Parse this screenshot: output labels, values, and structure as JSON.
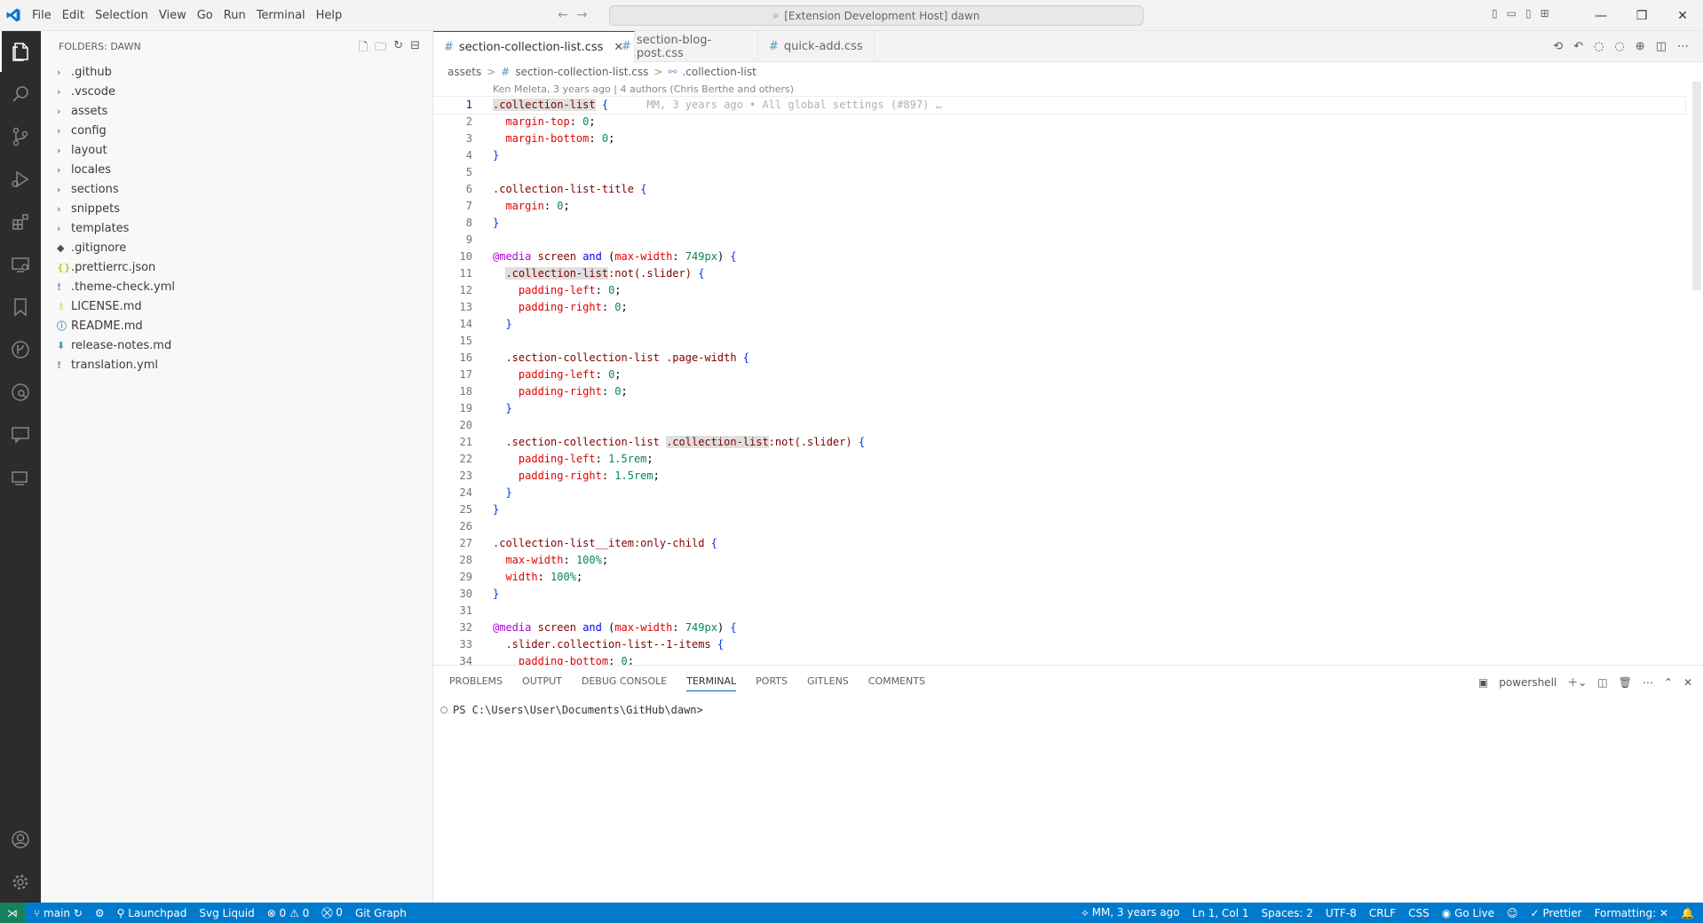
{
  "menubar": {
    "items": [
      "File",
      "Edit",
      "Selection",
      "View",
      "Go",
      "Run",
      "Terminal",
      "Help"
    ]
  },
  "title": {
    "nav_back": "←",
    "nav_forward": "→",
    "command_center": "[Extension Development Host] dawn"
  },
  "window_controls": {
    "minimize": "—",
    "restore": "❐",
    "close": "✕"
  },
  "sidebar": {
    "header": "FOLDERS: DAWN",
    "items": [
      {
        "label": ".github",
        "type": "folder"
      },
      {
        "label": ".vscode",
        "type": "folder"
      },
      {
        "label": "assets",
        "type": "folder"
      },
      {
        "label": "config",
        "type": "folder"
      },
      {
        "label": "layout",
        "type": "folder"
      },
      {
        "label": "locales",
        "type": "folder"
      },
      {
        "label": "sections",
        "type": "folder"
      },
      {
        "label": "snippets",
        "type": "folder"
      },
      {
        "label": "templates",
        "type": "folder"
      },
      {
        "label": ".gitignore",
        "type": "file",
        "icon": "◆",
        "color": "#41535b"
      },
      {
        "label": ".prettierrc.json",
        "type": "file",
        "icon": "{}",
        "color": "#cbcb41"
      },
      {
        "label": ".theme-check.yml",
        "type": "file",
        "icon": "!",
        "color": "#a074c4"
      },
      {
        "label": "LICENSE.md",
        "type": "file",
        "icon": "♗",
        "color": "#cbcb41"
      },
      {
        "label": "README.md",
        "type": "file",
        "icon": "ⓘ",
        "color": "#519aba"
      },
      {
        "label": "release-notes.md",
        "type": "file",
        "icon": "⬇",
        "color": "#519aba"
      },
      {
        "label": "translation.yml",
        "type": "file",
        "icon": "!",
        "color": "#a074c4"
      }
    ]
  },
  "tabs": [
    {
      "label": "section-collection-list.css",
      "active": true,
      "close": "✕"
    },
    {
      "label": "section-blog-post.css",
      "active": false
    },
    {
      "label": "quick-add.css",
      "active": false
    }
  ],
  "breadcrumbs": {
    "folder": "assets",
    "file": "section-collection-list.css",
    "symbol": ".collection-list",
    "sep": ">"
  },
  "blame": {
    "header": "Ken Meleta, 3 years ago | 4 authors (Chris Berthe and others)",
    "inline": "MM, 3 years ago • All global settings (#897) …"
  },
  "code": {
    "lines": [
      "1",
      "2",
      "3",
      "4",
      "5",
      "6",
      "7",
      "8",
      "9",
      "10",
      "11",
      "12",
      "13",
      "14",
      "15",
      "16",
      "17",
      "18",
      "19",
      "20",
      "21",
      "22",
      "23",
      "24",
      "25",
      "26",
      "27",
      "28",
      "29",
      "30",
      "31",
      "32",
      "33",
      "34"
    ]
  },
  "panel": {
    "tabs": [
      "PROBLEMS",
      "OUTPUT",
      "DEBUG CONSOLE",
      "TERMINAL",
      "PORTS",
      "GITLENS",
      "COMMENTS"
    ],
    "active_tab": "TERMINAL",
    "shell": "powershell",
    "prompt": "PS C:\\Users\\User\\Documents\\GitHub\\dawn>"
  },
  "statusbar": {
    "branch": "main",
    "launchpad": "Launchpad",
    "svg_liquid": "Svg Liquid",
    "problems": "⊗ 0 ⚠ 0",
    "ports": "0",
    "git_graph": "Git Graph",
    "blame": "MM, 3 years ago",
    "cursor": "Ln 1, Col 1",
    "spaces": "Spaces: 2",
    "encoding": "UTF-8",
    "eol": "CRLF",
    "language": "CSS",
    "go_live": "Go Live",
    "prettier": "Prettier",
    "formatting": "Formatting: ✕"
  },
  "colors": {
    "activitybar": "#2c2c2c",
    "statusbar": "#007acc",
    "accent": "#005fb8"
  }
}
